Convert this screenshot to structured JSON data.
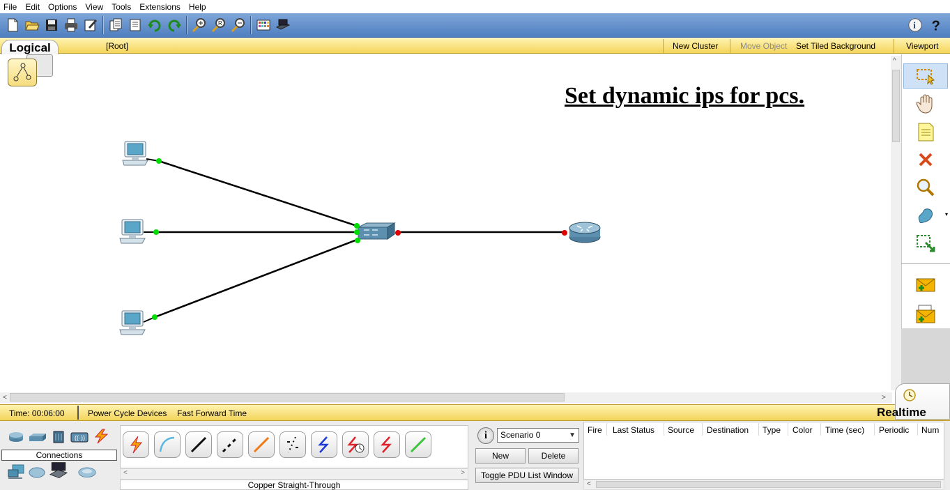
{
  "menu": [
    "File",
    "Edit",
    "Options",
    "View",
    "Tools",
    "Extensions",
    "Help"
  ],
  "logical_bar": {
    "tab": "Logical",
    "root": "[Root]",
    "new_cluster": "New Cluster",
    "move_object": "Move Object",
    "set_tiled_background": "Set Tiled Background",
    "viewport": "Viewport"
  },
  "workspace": {
    "title": "Set dynamic ips for  pcs.",
    "devices": [
      {
        "type": "pc"
      },
      {
        "type": "pc"
      },
      {
        "type": "pc"
      },
      {
        "type": "switch"
      },
      {
        "type": "router"
      }
    ],
    "link_status": {
      "pc_links": "green",
      "switch_router_link": "red"
    }
  },
  "realtime_bar": {
    "time": "Time: 00:06:00",
    "power_cycle": "Power Cycle Devices",
    "fast_forward": "Fast Forward Time",
    "mode": "Realtime"
  },
  "bottom": {
    "category_label": "Connections",
    "selected_cable": "Copper Straight-Through",
    "scenario": "Scenario 0",
    "new_button": "New",
    "delete_button": "Delete",
    "toggle_pdu": "Toggle PDU List Window",
    "pdu_columns": [
      "Fire",
      "Last Status",
      "Source",
      "Destination",
      "Type",
      "Color",
      "Time (sec)",
      "Periodic",
      "Num"
    ]
  },
  "colors": {
    "toolbar_blue": "#5a88c8",
    "logical_yellow": "#f6dc6c",
    "link_up": "#00dd00",
    "link_down": "#e00000"
  }
}
